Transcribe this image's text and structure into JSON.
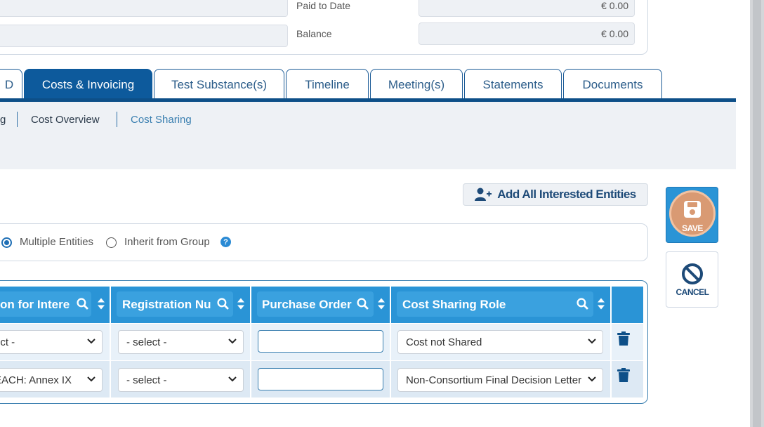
{
  "summary": {
    "paid_to_date_label": "Paid to Date",
    "paid_to_date_value": "€ 0.00",
    "balance_label": "Balance",
    "balance_value": "€ 0.00"
  },
  "tabs": [
    {
      "label": "D"
    },
    {
      "label": "Costs & Invoicing",
      "active": true
    },
    {
      "label": "Test Substance(s)"
    },
    {
      "label": "Timeline"
    },
    {
      "label": "Meeting(s)"
    },
    {
      "label": "Statements"
    },
    {
      "label": "Documents"
    }
  ],
  "subnav": [
    {
      "label": "g"
    },
    {
      "label": "Cost Overview"
    },
    {
      "label": "Cost Sharing",
      "active": true
    }
  ],
  "add_all_button": {
    "label": "Add All Interested Entities",
    "icon": "user-plus-icon"
  },
  "radio_options": [
    {
      "label": "Multiple Entities",
      "checked": true
    },
    {
      "label": "Inherit from Group",
      "checked": false,
      "help": "?"
    }
  ],
  "grid": {
    "columns": [
      {
        "label": "on for Intere"
      },
      {
        "label": "Registration Nu"
      },
      {
        "label": "Purchase Order"
      },
      {
        "label": "Cost Sharing Role"
      }
    ],
    "rows": [
      {
        "reason": "ect -",
        "registration": "- select -",
        "purchase_order": "",
        "role": "Cost not Shared"
      },
      {
        "reason": "EACH: Annex IX",
        "registration": "- select -",
        "purchase_order": "",
        "role": "Non-Consortium Final Decision Letter"
      }
    ]
  },
  "actions": {
    "save_label": "SAVE",
    "cancel_label": "CANCEL"
  },
  "colors": {
    "primary": "#0d5a9c",
    "grid_header": "#2a94d6",
    "save_circle": "#d99a73"
  }
}
